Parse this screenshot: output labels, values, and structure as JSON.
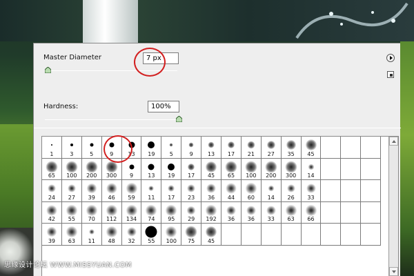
{
  "panel": {
    "master_diameter_label": "Master Diameter",
    "master_diameter_value": "7 px",
    "master_diameter_level": 0.02,
    "hardness_label": "Hardness:",
    "hardness_value": "100%",
    "hardness_level": 1.0,
    "menu_icon": "flyout-arrow-icon",
    "new_preset_icon": "new-preset-icon"
  },
  "brushes": [
    {
      "n": "1",
      "t": "hard"
    },
    {
      "n": "3",
      "t": "hard"
    },
    {
      "n": "5",
      "t": "hard"
    },
    {
      "n": "9",
      "t": "hard"
    },
    {
      "n": "13",
      "t": "hard"
    },
    {
      "n": "19",
      "t": "hard"
    },
    {
      "n": "5",
      "t": "soft"
    },
    {
      "n": "9",
      "t": "soft"
    },
    {
      "n": "13",
      "t": "soft"
    },
    {
      "n": "17",
      "t": "soft"
    },
    {
      "n": "21",
      "t": "soft"
    },
    {
      "n": "27",
      "t": "soft"
    },
    {
      "n": "35",
      "t": "soft"
    },
    {
      "n": "45",
      "t": "soft"
    },
    {
      "n": "",
      "t": "blank"
    },
    {
      "n": "",
      "t": "blank"
    },
    {
      "n": "",
      "t": "blank"
    },
    {
      "n": "65",
      "t": "soft"
    },
    {
      "n": "100",
      "t": "soft"
    },
    {
      "n": "200",
      "t": "soft"
    },
    {
      "n": "300",
      "t": "soft"
    },
    {
      "n": "9",
      "t": "hard"
    },
    {
      "n": "13",
      "t": "hard"
    },
    {
      "n": "19",
      "t": "hard"
    },
    {
      "n": "17",
      "t": "soft"
    },
    {
      "n": "45",
      "t": "soft"
    },
    {
      "n": "65",
      "t": "soft"
    },
    {
      "n": "100",
      "t": "soft"
    },
    {
      "n": "200",
      "t": "soft"
    },
    {
      "n": "300",
      "t": "soft"
    },
    {
      "n": "14",
      "t": "special"
    },
    {
      "n": "",
      "t": "blank"
    },
    {
      "n": "",
      "t": "blank"
    },
    {
      "n": "",
      "t": "blank"
    },
    {
      "n": "24",
      "t": "special"
    },
    {
      "n": "27",
      "t": "special"
    },
    {
      "n": "39",
      "t": "special"
    },
    {
      "n": "46",
      "t": "special"
    },
    {
      "n": "59",
      "t": "special"
    },
    {
      "n": "11",
      "t": "special"
    },
    {
      "n": "17",
      "t": "special"
    },
    {
      "n": "23",
      "t": "special"
    },
    {
      "n": "36",
      "t": "special"
    },
    {
      "n": "44",
      "t": "special"
    },
    {
      "n": "60",
      "t": "special"
    },
    {
      "n": "14",
      "t": "special"
    },
    {
      "n": "26",
      "t": "special"
    },
    {
      "n": "33",
      "t": "special"
    },
    {
      "n": "",
      "t": "blank"
    },
    {
      "n": "",
      "t": "blank"
    },
    {
      "n": "",
      "t": "blank"
    },
    {
      "n": "42",
      "t": "special"
    },
    {
      "n": "55",
      "t": "special"
    },
    {
      "n": "70",
      "t": "special"
    },
    {
      "n": "112",
      "t": "special"
    },
    {
      "n": "134",
      "t": "special"
    },
    {
      "n": "74",
      "t": "special"
    },
    {
      "n": "95",
      "t": "special"
    },
    {
      "n": "29",
      "t": "special"
    },
    {
      "n": "192",
      "t": "special"
    },
    {
      "n": "36",
      "t": "special"
    },
    {
      "n": "36",
      "t": "special"
    },
    {
      "n": "33",
      "t": "special"
    },
    {
      "n": "63",
      "t": "special"
    },
    {
      "n": "66",
      "t": "special"
    },
    {
      "n": "",
      "t": "blank"
    },
    {
      "n": "",
      "t": "blank"
    },
    {
      "n": "",
      "t": "blank"
    },
    {
      "n": "39",
      "t": "special"
    },
    {
      "n": "63",
      "t": "special"
    },
    {
      "n": "11",
      "t": "special"
    },
    {
      "n": "48",
      "t": "special"
    },
    {
      "n": "32",
      "t": "special"
    },
    {
      "n": "55",
      "t": "hard"
    },
    {
      "n": "100",
      "t": "special"
    },
    {
      "n": "75",
      "t": "soft"
    },
    {
      "n": "45",
      "t": "soft"
    },
    {
      "n": "",
      "t": "blank"
    },
    {
      "n": "",
      "t": "blank"
    },
    {
      "n": "",
      "t": "blank"
    },
    {
      "n": "",
      "t": "blank"
    },
    {
      "n": "",
      "t": "blank"
    },
    {
      "n": "",
      "t": "blank"
    },
    {
      "n": "",
      "t": "blank"
    },
    {
      "n": "",
      "t": "blank"
    }
  ],
  "annotation_color": "#d21f1f",
  "watermark": "思缘设计论坛 WWW.MISSYUAN.COM"
}
